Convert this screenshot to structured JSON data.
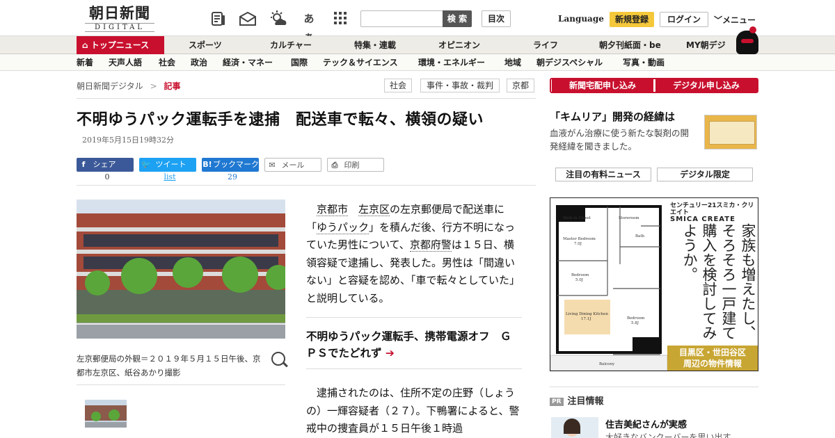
{
  "header": {
    "logo_jp": "朝日新聞",
    "logo_en": "DIGITAL",
    "icons": [
      "newspaper-icon",
      "mail-open-icon",
      "weather-icon",
      "kana-icon",
      "grid-icon"
    ],
    "kana_label": "あぁ",
    "search_placeholder": "",
    "search_button": "検 索",
    "index_button": "目次",
    "language": "Language",
    "register": "新規登録",
    "login": "ログイン",
    "menu": "メニュー"
  },
  "nav_primary": [
    "トップニュース",
    "スポーツ",
    "カルチャー",
    "特集・連載",
    "オピニオン",
    "ライフ",
    "朝夕刊紙面・be",
    "MY朝デジ"
  ],
  "nav_secondary": [
    "新着",
    "天声人語",
    "社会",
    "政治",
    "経済・マネー",
    "国際",
    "テック＆サイエンス",
    "環境・エネルギー",
    "地域",
    "朝デジスペシャル",
    "写真・動画"
  ],
  "breadcrumb": {
    "home": "朝日新聞デジタル",
    "sep": ">",
    "current": "記事"
  },
  "tags": [
    "社会",
    "事件・事故・裁判",
    "京都"
  ],
  "article": {
    "title": "不明ゆうパック運転手を逮捕　配送車で転々、横領の疑い",
    "date": "2019年5月15日19時32分",
    "share": {
      "facebook": "シェア",
      "facebook_count": "0",
      "twitter": "ツイート",
      "twitter_count": "list",
      "hatena": "ブックマーク",
      "hatena_count": "29",
      "mail": "メール",
      "print": "印刷"
    },
    "photo_caption": "左京郵便局の外観＝２０１９年５月１５日午後、京都市左京区、紙谷あかり撮影",
    "body1": {
      "l1": "京都市",
      "l2": "左京区",
      "t1": "の左京郵便局で配送車に「",
      "l3": "ゆうパック",
      "t2": "」を積んだ後、行方不明になっていた男性について、",
      "l4": "京都府警",
      "t3": "は１５日、横領容疑で逮捕し、発表した。男性は「間違いない」と容疑を認め、「車で転々としていた」と説明している。"
    },
    "related": "不明ゆうパック運転手、携帯電源オフ　ＧＰＳでたどれず",
    "related_arrow": "➔",
    "body2": "逮捕されたのは、住所不定の庄野（しょうの）一輝容疑者（２７）。下鴨署によると、警戒中の捜査員が１５日午後１時過"
  },
  "sidebar": {
    "subscribe_delivery": "新聞宅配申し込み",
    "subscribe_digital": "デジタル申し込み",
    "promo_title": "「キムリア」開発の経緯は",
    "promo_desc": "血液がん治療に使う新たな製剤の開発経緯を聞きました。",
    "tab_paid_news": "注目の有料ニュース",
    "tab_digital_only": "デジタル限定",
    "ad": {
      "brand": "センチュリー21スミカ・クリエイト",
      "brand_en": "SMICA CREATE",
      "copy": "家族も増えたし、そろそろ一戸建て購入を検討してみようか。",
      "area": "目黒区・世田谷区",
      "info": "周辺の物件情報",
      "rooms": [
        "Master Bedroom 7.0J",
        "Bedroom 5.0J",
        "Living Dining Kitchen 17.1J",
        "Bedroom 5.8J",
        "Walk in Closet",
        "Storeroom",
        "Bath",
        "Balcony"
      ]
    },
    "pr_badge": "PR",
    "pr_title": "注目情報",
    "pr_item_title": "住吉美紀さんが実感",
    "pr_item_desc": "大好きなバンクーバーを思い出す"
  }
}
